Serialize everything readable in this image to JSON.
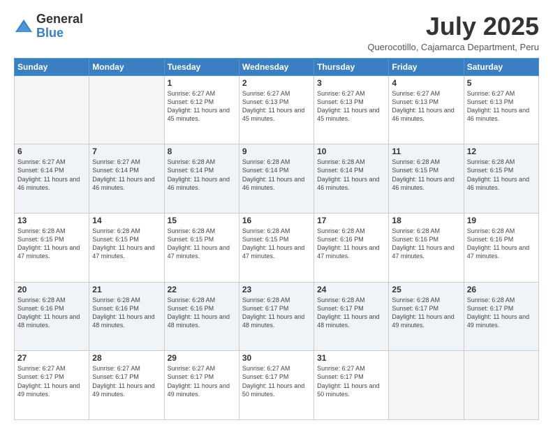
{
  "header": {
    "logo_general": "General",
    "logo_blue": "Blue",
    "month": "July 2025",
    "subtitle": "Querocotillo, Cajamarca Department, Peru"
  },
  "days_of_week": [
    "Sunday",
    "Monday",
    "Tuesday",
    "Wednesday",
    "Thursday",
    "Friday",
    "Saturday"
  ],
  "weeks": [
    [
      {
        "day": "",
        "detail": ""
      },
      {
        "day": "",
        "detail": ""
      },
      {
        "day": "1",
        "detail": "Sunrise: 6:27 AM\nSunset: 6:12 PM\nDaylight: 11 hours and 45 minutes."
      },
      {
        "day": "2",
        "detail": "Sunrise: 6:27 AM\nSunset: 6:13 PM\nDaylight: 11 hours and 45 minutes."
      },
      {
        "day": "3",
        "detail": "Sunrise: 6:27 AM\nSunset: 6:13 PM\nDaylight: 11 hours and 45 minutes."
      },
      {
        "day": "4",
        "detail": "Sunrise: 6:27 AM\nSunset: 6:13 PM\nDaylight: 11 hours and 46 minutes."
      },
      {
        "day": "5",
        "detail": "Sunrise: 6:27 AM\nSunset: 6:13 PM\nDaylight: 11 hours and 46 minutes."
      }
    ],
    [
      {
        "day": "6",
        "detail": "Sunrise: 6:27 AM\nSunset: 6:14 PM\nDaylight: 11 hours and 46 minutes."
      },
      {
        "day": "7",
        "detail": "Sunrise: 6:27 AM\nSunset: 6:14 PM\nDaylight: 11 hours and 46 minutes."
      },
      {
        "day": "8",
        "detail": "Sunrise: 6:28 AM\nSunset: 6:14 PM\nDaylight: 11 hours and 46 minutes."
      },
      {
        "day": "9",
        "detail": "Sunrise: 6:28 AM\nSunset: 6:14 PM\nDaylight: 11 hours and 46 minutes."
      },
      {
        "day": "10",
        "detail": "Sunrise: 6:28 AM\nSunset: 6:14 PM\nDaylight: 11 hours and 46 minutes."
      },
      {
        "day": "11",
        "detail": "Sunrise: 6:28 AM\nSunset: 6:15 PM\nDaylight: 11 hours and 46 minutes."
      },
      {
        "day": "12",
        "detail": "Sunrise: 6:28 AM\nSunset: 6:15 PM\nDaylight: 11 hours and 46 minutes."
      }
    ],
    [
      {
        "day": "13",
        "detail": "Sunrise: 6:28 AM\nSunset: 6:15 PM\nDaylight: 11 hours and 47 minutes."
      },
      {
        "day": "14",
        "detail": "Sunrise: 6:28 AM\nSunset: 6:15 PM\nDaylight: 11 hours and 47 minutes."
      },
      {
        "day": "15",
        "detail": "Sunrise: 6:28 AM\nSunset: 6:15 PM\nDaylight: 11 hours and 47 minutes."
      },
      {
        "day": "16",
        "detail": "Sunrise: 6:28 AM\nSunset: 6:15 PM\nDaylight: 11 hours and 47 minutes."
      },
      {
        "day": "17",
        "detail": "Sunrise: 6:28 AM\nSunset: 6:16 PM\nDaylight: 11 hours and 47 minutes."
      },
      {
        "day": "18",
        "detail": "Sunrise: 6:28 AM\nSunset: 6:16 PM\nDaylight: 11 hours and 47 minutes."
      },
      {
        "day": "19",
        "detail": "Sunrise: 6:28 AM\nSunset: 6:16 PM\nDaylight: 11 hours and 47 minutes."
      }
    ],
    [
      {
        "day": "20",
        "detail": "Sunrise: 6:28 AM\nSunset: 6:16 PM\nDaylight: 11 hours and 48 minutes."
      },
      {
        "day": "21",
        "detail": "Sunrise: 6:28 AM\nSunset: 6:16 PM\nDaylight: 11 hours and 48 minutes."
      },
      {
        "day": "22",
        "detail": "Sunrise: 6:28 AM\nSunset: 6:16 PM\nDaylight: 11 hours and 48 minutes."
      },
      {
        "day": "23",
        "detail": "Sunrise: 6:28 AM\nSunset: 6:17 PM\nDaylight: 11 hours and 48 minutes."
      },
      {
        "day": "24",
        "detail": "Sunrise: 6:28 AM\nSunset: 6:17 PM\nDaylight: 11 hours and 48 minutes."
      },
      {
        "day": "25",
        "detail": "Sunrise: 6:28 AM\nSunset: 6:17 PM\nDaylight: 11 hours and 49 minutes."
      },
      {
        "day": "26",
        "detail": "Sunrise: 6:28 AM\nSunset: 6:17 PM\nDaylight: 11 hours and 49 minutes."
      }
    ],
    [
      {
        "day": "27",
        "detail": "Sunrise: 6:27 AM\nSunset: 6:17 PM\nDaylight: 11 hours and 49 minutes."
      },
      {
        "day": "28",
        "detail": "Sunrise: 6:27 AM\nSunset: 6:17 PM\nDaylight: 11 hours and 49 minutes."
      },
      {
        "day": "29",
        "detail": "Sunrise: 6:27 AM\nSunset: 6:17 PM\nDaylight: 11 hours and 49 minutes."
      },
      {
        "day": "30",
        "detail": "Sunrise: 6:27 AM\nSunset: 6:17 PM\nDaylight: 11 hours and 50 minutes."
      },
      {
        "day": "31",
        "detail": "Sunrise: 6:27 AM\nSunset: 6:17 PM\nDaylight: 11 hours and 50 minutes."
      },
      {
        "day": "",
        "detail": ""
      },
      {
        "day": "",
        "detail": ""
      }
    ]
  ]
}
